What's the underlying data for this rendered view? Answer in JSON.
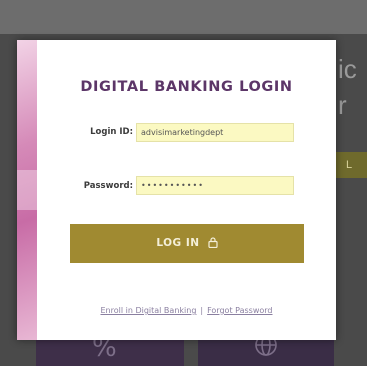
{
  "background": {
    "right_text_line1": "ic",
    "right_text_line2": "r",
    "right_button_label": "L"
  },
  "modal": {
    "title": "DIGITAL BANKING LOGIN",
    "login_id_label": "Login ID:",
    "login_id_value": "advisimarketingdept",
    "password_label": "Password:",
    "password_value": "•••••••••••",
    "login_button_label": "LOG IN",
    "enroll_link": "Enroll in Digital Banking",
    "separator": "|",
    "forgot_link": "Forgot Password"
  },
  "icons": {
    "lock": "lock-icon",
    "percent": "percent-icon",
    "globe": "globe-icon"
  },
  "colors": {
    "title": "#5c3668",
    "button": "#a08a31",
    "field_bg": "#fbf9c2",
    "link": "#8a7fa0"
  }
}
